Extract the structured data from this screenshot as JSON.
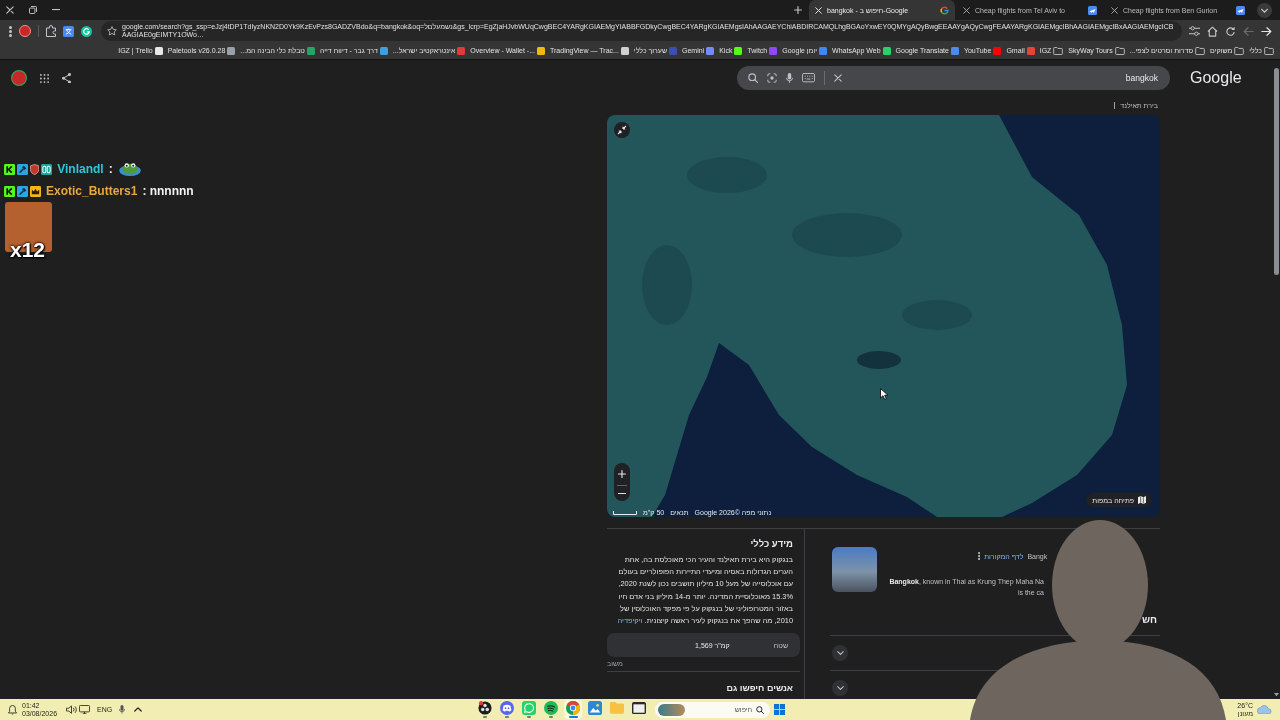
{
  "browser": {
    "tabs": [
      {
        "kind": "flights",
        "title": "Cheap flights from Ben Gurion",
        "selected": false
      },
      {
        "kind": "flights",
        "title": "Cheap flights from Tel Aviv to",
        "selected": false
      },
      {
        "kind": "search",
        "title": "bangkok - חיפוש ב-Google",
        "selected": true
      }
    ],
    "url": "google.com/search?gs_ssp=eJzj4tDP1TdIyzNKN2D0Yk9KzEvPzs8GADZVBdo&q=bangkok&oq=נשמעלםל&gs_lcrp=EgZjaHJvbWUqCwgBEC4YARgKGIAEMgYIABBFGDkyCwgBEC4YARgKGIAEMgsIAhAAGAEYChiABDIRCAMQLhgBGAoYxwEY0QMYgAQyBwgEEAAYgAQyCwgFEAAYARgKGIAEMgcIBhAAGIAEMgcIBxAAGIAEMgcICBAAGIAE0gEIMTY1OWo…",
    "nav": [
      {
        "kind": "forward",
        "disabled": true
      },
      {
        "kind": "back",
        "disabled": false
      }
    ],
    "bookmarks": [
      {
        "label": "כללי",
        "kind": "folder"
      },
      {
        "label": "משוקים",
        "kind": "folder"
      },
      {
        "label": "סדרות וסרטים לצפי...",
        "kind": "folder"
      },
      {
        "label": "SkyWay Tours",
        "kind": "folder"
      },
      {
        "label": "IGZ",
        "kind": "folder"
      },
      {
        "label": "Gmail",
        "kind": "site",
        "color": "#ea4335"
      },
      {
        "label": "YouTube",
        "kind": "site",
        "color": "#ff0000"
      },
      {
        "label": "Google Translate",
        "kind": "site",
        "color": "#4a8af4"
      },
      {
        "label": "WhatsApp Web",
        "kind": "site",
        "color": "#25d366"
      },
      {
        "label": "Google יומן",
        "kind": "site",
        "color": "#4285f4"
      },
      {
        "label": "Twitch",
        "kind": "site",
        "color": "#9146ff"
      },
      {
        "label": "Kick",
        "kind": "site",
        "color": "#53fc18"
      },
      {
        "label": "Gemini",
        "kind": "site",
        "color": "#6f8cff"
      },
      {
        "label": "שערוך כללי",
        "kind": "site",
        "color": "#3a4fb0"
      },
      {
        "label": "TradingView — Trac...",
        "kind": "site",
        "color": "#d0d0d0"
      },
      {
        "label": "Overview - Wallet -...",
        "kind": "site",
        "color": "#f0b90b"
      },
      {
        "label": "אינטראקטיב ישראל...",
        "kind": "site",
        "color": "#e03a3a"
      },
      {
        "label": "דרך גבר - דיווח דייה",
        "kind": "site",
        "color": "#3aa0e0"
      },
      {
        "label": "טבלת כלי הבינה המ...",
        "kind": "site",
        "color": "#23a566"
      },
      {
        "label": "Paletools v26.0.28",
        "kind": "site",
        "color": "#9aa0a6"
      },
      {
        "label": "IGZ | Trello",
        "kind": "site",
        "color": "#e8e8e8"
      }
    ]
  },
  "page": {
    "search": {
      "value": "bangkok"
    },
    "logo": "Google",
    "subtitle": "בירת תאילנד",
    "map": {
      "open_button": "פתיחה במפות",
      "scale": "50 ק\"מ",
      "terms": "תנאים",
      "attribution": "נתוני מפה ©2026 Google"
    },
    "about": {
      "heading": "מידע כללי",
      "text": "בנגקוק היא בירת תאילנד והעיר הכי מאוכלסת בה, אחת הערים הגדולות באסיה ומיעדי התיירות הפופולריים בעולם עם אוכלוסייה של מעל 10 מיליון תושבים נכון לשנת 2020, 15.3% מאוכלוסיית המדינה. יותר מ-14 מיליון בני אדם חיו באזור המטרופוליני של בנגקוק על פי מפקד האוכלוסין של 2010, מה שהפך את בנגקוק לעיר ראשה קיצונית.",
      "link": "ויקיפדיה",
      "facts": [
        {
          "label": "שטח",
          "value": "1,569 קמ\"ר"
        }
      ],
      "feedback": "משוב"
    },
    "people_also_search": {
      "heading": "אנשים חיפשו גם"
    },
    "overview": {
      "source": "לדף המקורות",
      "site": "Bangk",
      "lines": [
        "**Bangkok**, known in Thai as Krung Thep Maha Na",
        "is the ca"
      ],
      "heading": "חש",
      "expanders": [
        {
          "expanded": false
        },
        {
          "expanded": false
        }
      ]
    }
  },
  "chat": {
    "messages": [
      {
        "user": "Vinlandl",
        "color": "#35c4d8",
        "badges": [
          {
            "kind": "kick"
          },
          {
            "kind": "mod"
          },
          {
            "kind": "shield"
          },
          {
            "kind": "og"
          }
        ],
        "text": ":",
        "emote": true
      },
      {
        "user": "Exotic_Butters1",
        "color": "#e7a83d",
        "badges": [
          {
            "kind": "kick"
          },
          {
            "kind": "mod"
          },
          {
            "kind": "crown"
          }
        ],
        "text": ": nnnnnn",
        "emote": false
      }
    ],
    "combo": {
      "count": "x12"
    }
  },
  "taskbar": {
    "time": "01:42",
    "date": "03/08/2026",
    "language": "ENG",
    "apps": [
      {
        "kind": "recorder",
        "running": true,
        "active": false
      },
      {
        "kind": "discord",
        "running": true,
        "active": false
      },
      {
        "kind": "whatsapp",
        "running": true,
        "active": false
      },
      {
        "kind": "spotify",
        "running": true,
        "active": false
      },
      {
        "kind": "chrome",
        "running": true,
        "active": true
      },
      {
        "kind": "photos",
        "running": false,
        "active": false
      },
      {
        "kind": "files",
        "running": false,
        "active": false
      },
      {
        "kind": "terminal",
        "running": false,
        "active": false
      }
    ],
    "search": {
      "placeholder": "חיפוש"
    },
    "weather": {
      "temperature": "26°C",
      "condition": "מעונן"
    }
  }
}
